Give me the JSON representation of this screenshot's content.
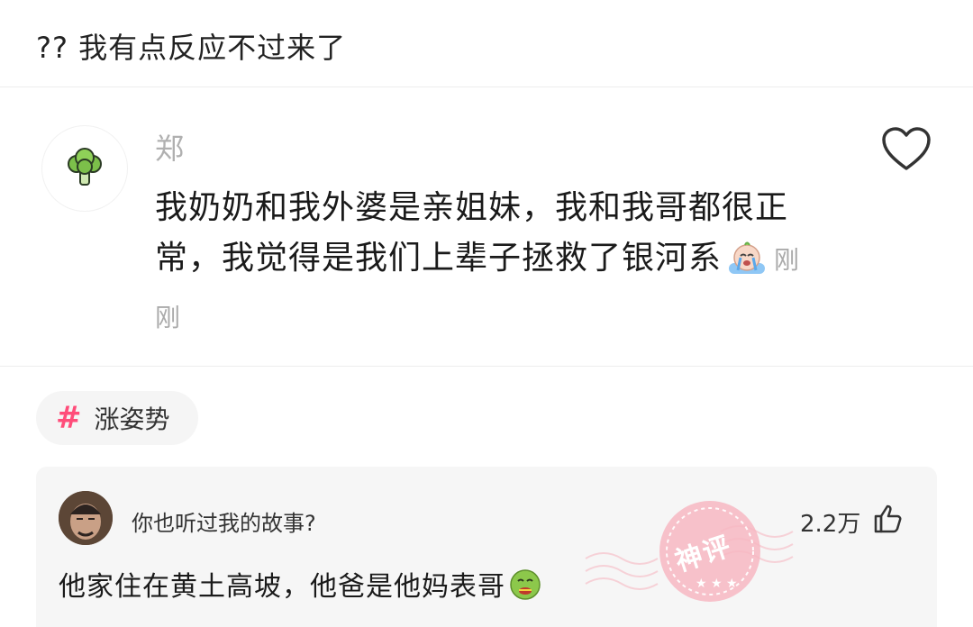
{
  "post": {
    "title": "?? 我有点反应不过来了"
  },
  "quote": {
    "author": "郑",
    "text": "我奶奶和我外婆是亲姐妹，我和我哥都很正常，我觉得是我们上辈子拯救了银河系",
    "time": "刚刚",
    "avatar_icon": "broccoli-icon",
    "like_icon": "heart-outline-icon"
  },
  "tag": {
    "symbol": "#",
    "label": "涨姿势",
    "color": "#ff4d7a"
  },
  "comment": {
    "username": "你也听过我的故事?",
    "likes": "2.2万",
    "text": "他家住在黄土高坡，他爸是他妈表哥",
    "badge": "神评",
    "badge_color": "#f4a3b0"
  }
}
